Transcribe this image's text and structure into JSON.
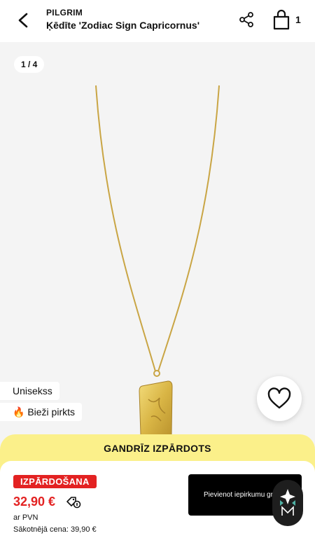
{
  "header": {
    "brand": "PILGRIM",
    "title": "Ķēdīte 'Zodiac Sign Capricornus'",
    "cart_count": "1"
  },
  "gallery": {
    "pager": "1 / 4",
    "badges": [
      "Unisekss",
      "🔥 Bieži pirkts"
    ]
  },
  "availability": {
    "text": "GANDRĪZ IZPĀRDOTS",
    "color": "#fbf08a"
  },
  "pricing": {
    "sale_label": "IZPĀRDOŠANA",
    "price": "32,90 €",
    "vat": "ar PVN",
    "original": "Sākotnējā cena: 39,90 €",
    "sale_color": "#e32222"
  },
  "actions": {
    "add_to_cart": "Pievienot iepirkumu groza"
  }
}
